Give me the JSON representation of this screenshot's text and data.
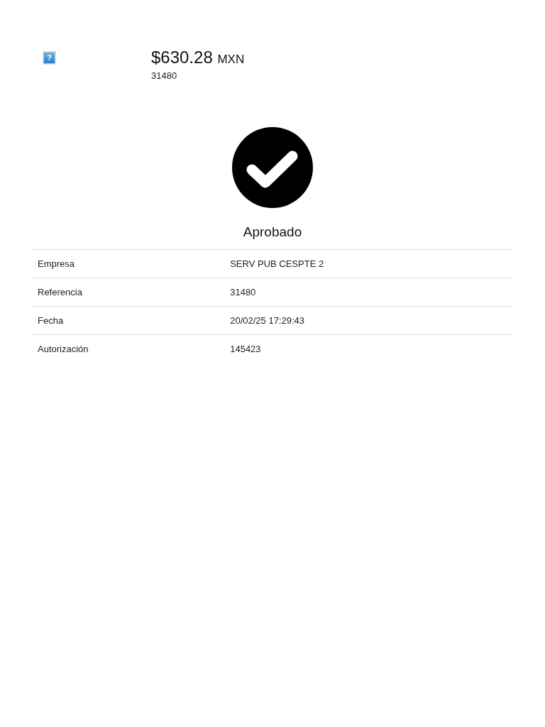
{
  "image_placeholder": {
    "glyph": "?"
  },
  "payment": {
    "amount": "$630.28",
    "currency": "MXN",
    "reference": "31480"
  },
  "status": {
    "kind": "approved",
    "label": "Aprobado"
  },
  "details": {
    "rows": [
      {
        "label": "Empresa",
        "value": "SERV PUB CESPTE 2"
      },
      {
        "label": "Referencia",
        "value": "31480"
      },
      {
        "label": "Fecha",
        "value": "20/02/25 17:29:43"
      },
      {
        "label": "Autorización",
        "value": "145423"
      }
    ]
  }
}
